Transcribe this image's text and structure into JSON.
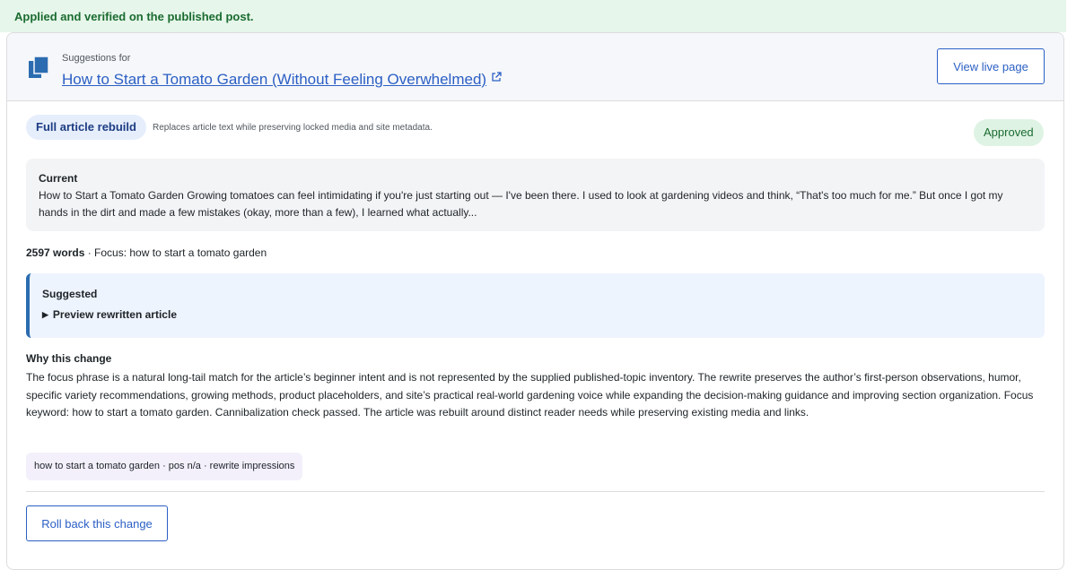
{
  "notice": {
    "text": "Applied and verified on the published post."
  },
  "header": {
    "suggestions_label": "Suggestions for",
    "post_title": "How to Start a Tomato Garden (Without Feeling Overwhelmed)",
    "view_live_label": "View live page"
  },
  "change": {
    "type_label": "Full article rebuild",
    "type_description": "Replaces article text while preserving locked media and site metadata.",
    "status": "Approved"
  },
  "current": {
    "label": "Current",
    "text": "How to Start a Tomato Garden Growing tomatoes can feel intimidating if you're just starting out — I've been there. I used to look at gardening videos and think, “That's too much for me.” But once I got my hands in the dirt and made a few mistakes (okay, more than a few), I learned what actually..."
  },
  "meta": {
    "word_count": "2597 words",
    "focus": " · Focus: how to start a tomato garden"
  },
  "suggested": {
    "label": "Suggested",
    "preview_label": "Preview rewritten article"
  },
  "why": {
    "label": "Why this change",
    "text": "The focus phrase is a natural long-tail match for the article’s beginner intent and is not represented by the supplied published-topic inventory. The rewrite preserves the author’s first-person observations, humor, specific variety recommendations, growing methods, product placeholders, and site’s practical real-world gardening voice while expanding the decision-making guidance and improving section organization. Focus keyword: how to start a tomato garden. Cannibalization check passed. The article was rebuilt around distinct reader needs while preserving existing media and links."
  },
  "tag": {
    "text": "how to start a tomato garden · pos n/a · rewrite impressions"
  },
  "actions": {
    "rollback_label": "Roll back this change"
  },
  "colors": {
    "accent": "#2b5fc4",
    "success_bg": "#e6f6ea",
    "success_text": "#1a6b30",
    "suggested_border": "#2b6cb0"
  },
  "icons": {
    "doc": "document-stack-icon",
    "external": "external-link-icon",
    "toggle": "triangle-right-icon"
  }
}
